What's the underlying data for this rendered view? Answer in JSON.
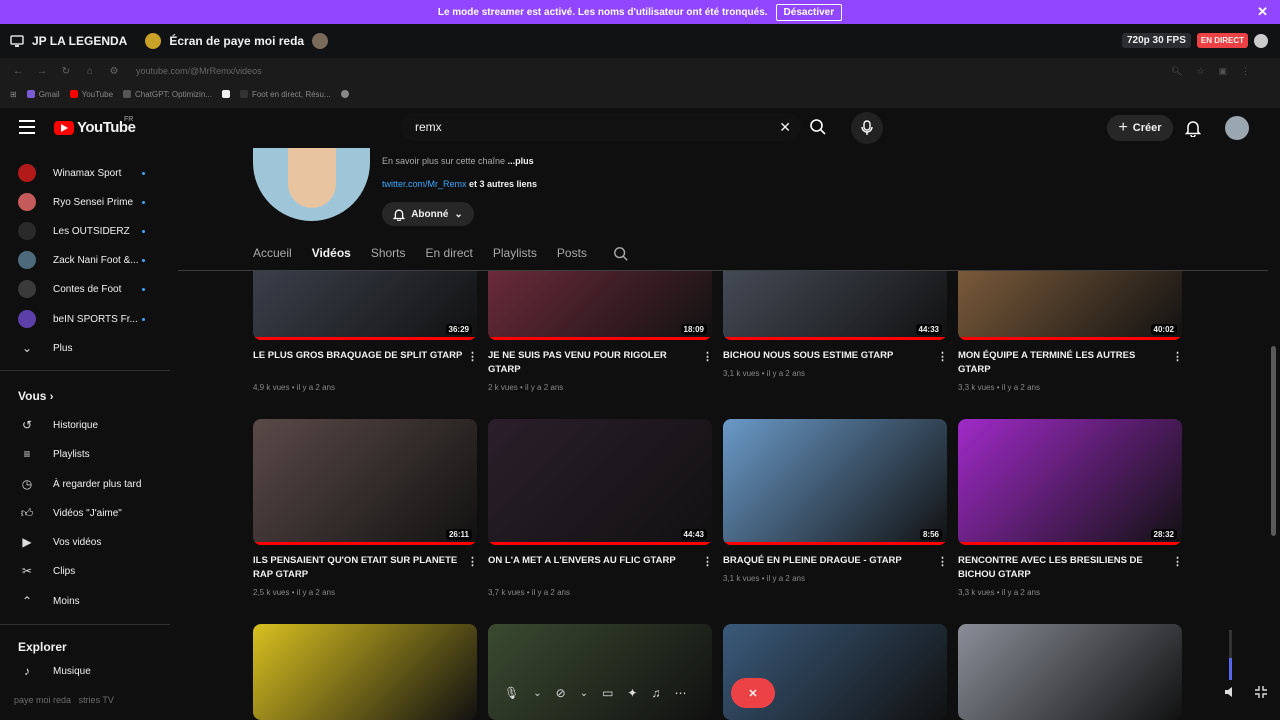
{
  "banner": {
    "text": "Le mode streamer est activé. Les noms d'utilisateur ont été tronqués.",
    "button": "Désactiver",
    "close": "✕"
  },
  "stream": {
    "streamer": "JP LA LEGENDA",
    "title": "Écran de paye moi reda",
    "quality": "720p 30 FPS",
    "live": "EN DIRECT"
  },
  "browser": {
    "url": "youtube.com/@MrRemx/videos",
    "bookmarks": [
      "Gmail",
      "YouTube",
      "ChatGPT: Optimizin...",
      "Foot en direct, Résu..."
    ]
  },
  "header": {
    "logo": "YouTube",
    "region": "FR",
    "search_value": "remx",
    "create": "Créer"
  },
  "sidebar": {
    "subscriptions": [
      {
        "label": "Winamax Sport",
        "color": "#b21a1a"
      },
      {
        "label": "Ryo Sensei Prime",
        "color": "#c45a5a"
      },
      {
        "label": "Les OUTSIDERZ",
        "color": "#222222"
      },
      {
        "label": "Zack Nani Foot &...",
        "color": "#4d6a7a"
      },
      {
        "label": "Contes de Foot",
        "color": "#3a3a3a"
      },
      {
        "label": "beIN SPORTS Fr...",
        "color": "#5d3fa8"
      }
    ],
    "more": "Plus",
    "you_section": "Vous",
    "you_items": [
      {
        "label": "Historique",
        "icon": "history-icon"
      },
      {
        "label": "Playlists",
        "icon": "playlist-icon"
      },
      {
        "label": "À regarder plus tard",
        "icon": "clock-icon"
      },
      {
        "label": "Vidéos \"J'aime\"",
        "icon": "thumb-up-icon"
      },
      {
        "label": "Vos vidéos",
        "icon": "video-icon"
      },
      {
        "label": "Clips",
        "icon": "scissors-icon"
      },
      {
        "label": "Moins",
        "icon": "chevron-up-icon"
      }
    ],
    "explore_section": "Explorer",
    "explore_items": [
      {
        "label": "Musique",
        "icon": "music-icon"
      }
    ]
  },
  "channel": {
    "more_text": "En savoir plus sur cette chaîne",
    "more_link": "...plus",
    "link": "twitter.com/Mr_Remx",
    "other_links": "et 3 autres liens",
    "subscribed": "Abonné"
  },
  "tabs": [
    "Accueil",
    "Vidéos",
    "Shorts",
    "En direct",
    "Playlists",
    "Posts"
  ],
  "videos": [
    {
      "title": "LE PLUS GROS BRAQUAGE DE SPLIT GTARP",
      "duration": "36:29",
      "views": "4,9 k vues",
      "age": "il y a 2 ans",
      "progress": 1.0,
      "thumb": "#3a3f4a"
    },
    {
      "title": "JE NE SUIS PAS VENU POUR RIGOLER GTARP",
      "duration": "18:09",
      "views": "2 k vues",
      "age": "il y a 2 ans",
      "progress": 1.0,
      "thumb": "#6a2a3a"
    },
    {
      "title": "BICHOU NOUS SOUS ESTIME GTARP",
      "duration": "44:33",
      "views": "3,1 k vues",
      "age": "il y a 2 ans",
      "progress": 1.0,
      "thumb": "#444a55"
    },
    {
      "title": "MON ÉQUIPE A TERMINÉ LES AUTRES GTARP",
      "duration": "40:02",
      "views": "3,3 k vues",
      "age": "il y a 2 ans",
      "progress": 1.0,
      "thumb": "#7a5a3a"
    },
    {
      "title": "ILS PENSAIENT QU'ON ETAIT SUR PLANETE RAP GTARP",
      "duration": "26:11",
      "views": "2,5 k vues",
      "age": "il y a 2 ans",
      "progress": 1.0,
      "thumb": "#5a4a48"
    },
    {
      "title": "ON L'A MET A L'ENVERS AU FLIC GTARP",
      "duration": "44:43",
      "views": "3,7 k vues",
      "age": "il y a 2 ans",
      "progress": 1.0,
      "thumb": "#2a1e2a"
    },
    {
      "title": "BRAQUÉ EN PLEINE DRAGUE - GTARP",
      "duration": "8:56",
      "views": "3,1 k vues",
      "age": "il y a 2 ans",
      "progress": 1.0,
      "thumb": "#6a9ac8"
    },
    {
      "title": "RENCONTRE AVEC LES BRESILIENS DE BICHOU GTARP",
      "duration": "28:32",
      "views": "3,3 k vues",
      "age": "il y a 2 ans",
      "progress": 1.0,
      "thumb": "#a02ac8"
    },
    {
      "title": "",
      "duration": "",
      "views": "",
      "age": "",
      "progress": 0,
      "thumb": "#d8c020"
    },
    {
      "title": "",
      "duration": "",
      "views": "",
      "age": "",
      "progress": 0,
      "thumb": "#3a4a30"
    },
    {
      "title": "",
      "duration": "",
      "views": "",
      "age": "",
      "progress": 0,
      "thumb": "#3a5a7a"
    },
    {
      "title": "",
      "duration": "",
      "views": "",
      "age": "",
      "progress": 0,
      "thumb": "#8a8e98"
    }
  ],
  "footer": {
    "left_text": "paye moi reda",
    "left_text2": "stries TV"
  },
  "colors": {
    "accent": "#9146ff",
    "youtube_red": "#ff0000",
    "live_red": "#ed4245"
  }
}
